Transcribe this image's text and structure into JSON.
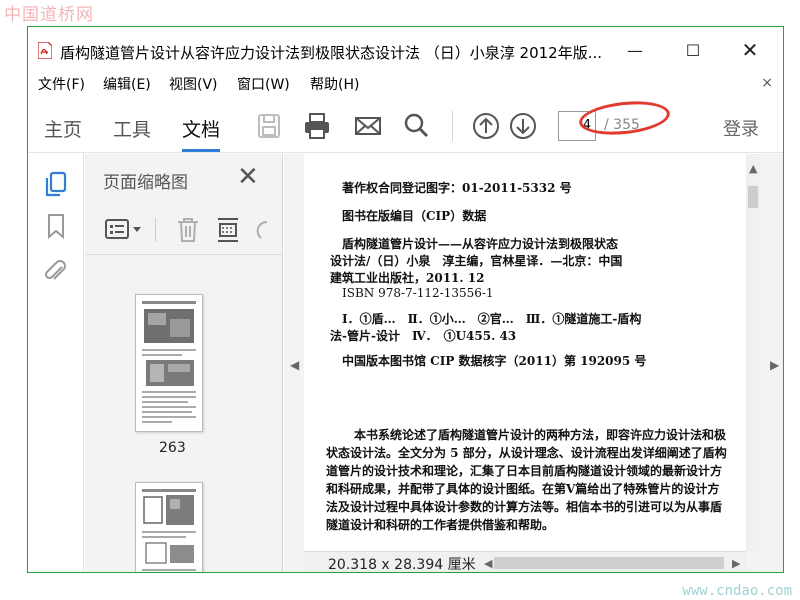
{
  "watermarks": {
    "top": "中国道桥网",
    "bottom": "www.cndao.com"
  },
  "window": {
    "title": "盾构隧道管片设计从容许应力设计法到极限状态设计法 （日）小泉淳 2012年版...",
    "controls": {
      "minimize": "—",
      "maximize": "☐",
      "close": "✕"
    }
  },
  "menu": {
    "items": [
      "文件(F)",
      "编辑(E)",
      "视图(V)",
      "窗口(W)",
      "帮助(H)"
    ],
    "close": "×"
  },
  "toolbar": {
    "tabs": [
      "主页",
      "工具",
      "文档"
    ],
    "active_tab": "文档",
    "icons": [
      "save-icon",
      "print-icon",
      "mail-icon",
      "search-icon",
      "page-up-icon",
      "page-down-icon"
    ],
    "page_current": "4",
    "page_total": "/ 355",
    "login": "登录",
    "accent_color": "#2d7ed4",
    "highlight_color": "#e23a2f"
  },
  "thumbnails": {
    "title": "页面缩略图",
    "close": "✕",
    "pages": [
      {
        "number": "263"
      },
      {
        "number": ""
      }
    ]
  },
  "document": {
    "lines": [
      "著作权合同登记图字：01-2011-5332 号",
      "图书在版编目（CIP）数据",
      "盾构隧道管片设计——从容许应力设计法到极限状态",
      "设计法/（日）小泉　淳主编，官林星译．—北京：中国",
      "建筑工业出版社，2011. 12",
      "ISBN 978-7-112-13556-1",
      "Ⅰ．①盾…　Ⅱ．①小…　②官…　Ⅲ．①隧道施工-盾构",
      "法-管片-设计　Ⅳ．　①U455. 43",
      "中国版本图书馆 CIP 数据核字（2011）第 192095 号",
      "本书系统论述了盾构隧道管片设计的两种方法，即容许应力设计法和极",
      "状态设计法。全文分为 5 部分，从设计理念、设计流程出发详细阐述了盾构",
      "道管片的设计技术和理论，汇集了日本目前盾构隧道设计领域的最新设计方",
      "和科研成果，并配带了具体的设计图纸。在第Ⅴ篇给出了特殊管片的设计方",
      "法及设计过程中具体设计参数的计算方法等。相信本书的引进可以为从事盾",
      "隧道设计和科研的工作者提供借鉴和帮助。"
    ],
    "page_size": "20.318 x 28.394 厘米"
  }
}
